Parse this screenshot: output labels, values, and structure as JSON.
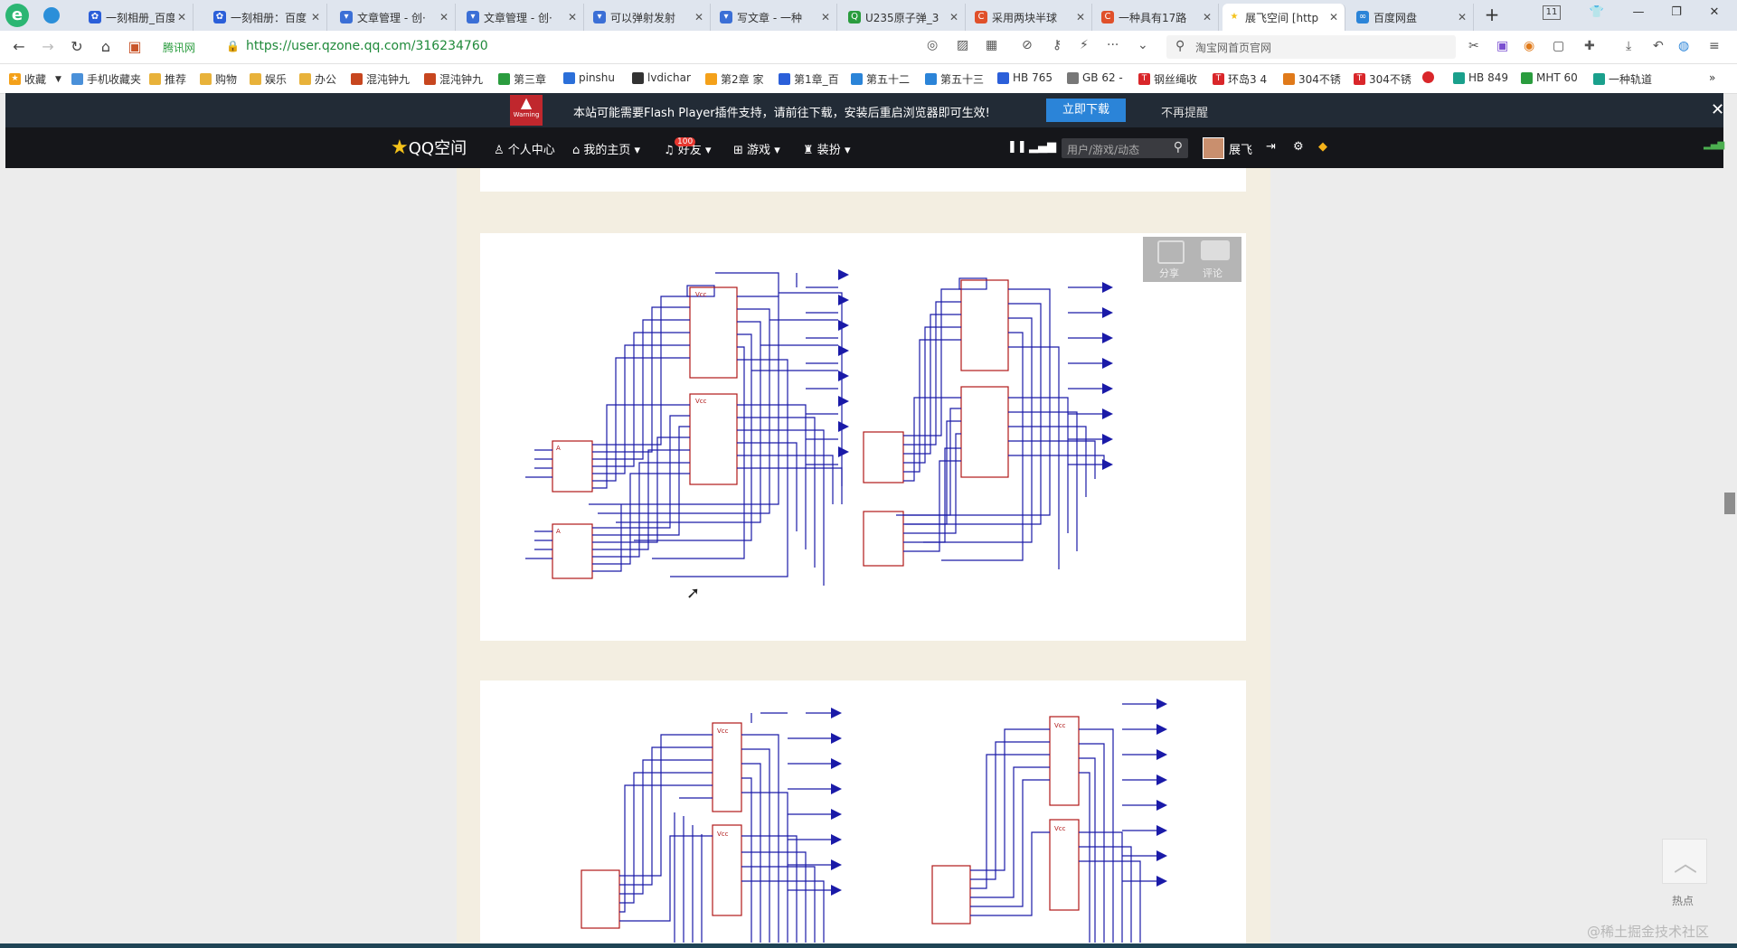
{
  "browser": {
    "tabs": [
      {
        "title": "一刻相册_百度",
        "color": "#2b5fd9",
        "active": false
      },
      {
        "title": "一刻相册：百度",
        "color": "#2b5fd9",
        "active": false
      },
      {
        "title": "文章管理 - 创·",
        "color": "#3b6fd6",
        "active": false
      },
      {
        "title": "文章管理 - 创·",
        "color": "#3b6fd6",
        "active": false
      },
      {
        "title": "可以弹射发射",
        "color": "#3b6fd6",
        "active": false
      },
      {
        "title": "写文章 - 一种",
        "color": "#3b6fd6",
        "active": false
      },
      {
        "title": "U235原子弹_3",
        "color": "#2a9c3e",
        "active": false
      },
      {
        "title": "采用两块半球",
        "color": "#e0502a",
        "active": false
      },
      {
        "title": "一种具有17路",
        "color": "#e0502a",
        "active": false
      },
      {
        "title": "展飞空间 [http",
        "color": "#f4c21a",
        "active": true
      },
      {
        "title": "百度网盘",
        "color": "#2b84d8",
        "active": false
      }
    ],
    "tab_count": "11",
    "address": {
      "site_label": "腾讯网",
      "url": "https://user.qzone.qq.com/316234760"
    },
    "search_placeholder": "淘宝网首页官网",
    "bookmarks": [
      {
        "label": "收藏",
        "color": "#f4a11a"
      },
      {
        "label": "手机收藏夹",
        "color": "#4a90d9"
      },
      {
        "label": "推荐",
        "color": "#e8b23a"
      },
      {
        "label": "购物",
        "color": "#e8b23a"
      },
      {
        "label": "娱乐",
        "color": "#e8b23a"
      },
      {
        "label": "办公",
        "color": "#e8b23a"
      },
      {
        "label": "混沌钟九",
        "color": "#c7461f"
      },
      {
        "label": "混沌钟九",
        "color": "#c7461f"
      },
      {
        "label": "第三章",
        "color": "#2a9c3e"
      },
      {
        "label": "pinshu",
        "color": "#2b6fd9"
      },
      {
        "label": "lvdichar",
        "color": "#333333"
      },
      {
        "label": "第2章 家",
        "color": "#f4a11a"
      },
      {
        "label": "第1章_百",
        "color": "#2b5fd9"
      },
      {
        "label": "第五十二",
        "color": "#2b84d8"
      },
      {
        "label": "第五十三",
        "color": "#2b84d8"
      },
      {
        "label": "HB 765",
        "color": "#2b5fd9"
      },
      {
        "label": "GB 62 -",
        "color": "#777777"
      },
      {
        "label": "钢丝绳收",
        "color": "#d9262a"
      },
      {
        "label": "环岛3 4",
        "color": "#d9262a"
      },
      {
        "label": "304不锈",
        "color": "#e07a1a"
      },
      {
        "label": "304不锈",
        "color": "#d9262a"
      },
      {
        "label": "",
        "color": "#d9262a"
      },
      {
        "label": "HB 849",
        "color": "#1aa08c"
      },
      {
        "label": "MHT 60",
        "color": "#2a9c3e"
      },
      {
        "label": "一种轨道",
        "color": "#1aa08c"
      }
    ]
  },
  "flash_notice": {
    "warning_label": "Warning",
    "message": "本站可能需要Flash Player插件支持，请前往下载，安装后重启浏览器即可生效!",
    "download_button": "立即下载",
    "dismiss": "不再提醒"
  },
  "qzone_nav": {
    "logo": "QQ空间",
    "personal_center": "个人中心",
    "my_home": "我的主页",
    "friends": "好友",
    "friends_badge": "100",
    "games": "游戏",
    "dress": "装扮",
    "search_placeholder": "用户/游戏/动态",
    "username": "展飞"
  },
  "photo_overlay": {
    "share": "分享",
    "comment": "评论"
  },
  "side": {
    "hot": "热点",
    "watermark": "@稀土掘金技术社区"
  },
  "colors": {
    "accent": "#2b84d8",
    "qzone_nav_bg": "#15161a",
    "flash_bar_bg": "#222b36",
    "schematic_wire": "#1a1aa8",
    "schematic_part": "#b01818"
  }
}
